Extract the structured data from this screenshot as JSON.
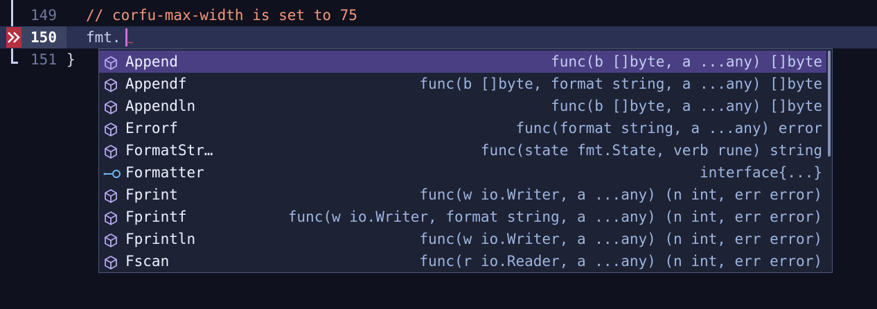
{
  "editor": {
    "lines": [
      {
        "number": "149",
        "text": "// corfu-max-width is set to 75",
        "kind": "comment"
      },
      {
        "number": "150",
        "text": "fmt.",
        "kind": "code",
        "current": true
      },
      {
        "number": "151",
        "text": "}",
        "kind": "code"
      }
    ]
  },
  "completion": {
    "selected_index": 0,
    "candidates": [
      {
        "label": "Append",
        "annotation": "func(b []byte, a ...any) []byte",
        "kind_icon": "function-cube-icon"
      },
      {
        "label": "Appendf",
        "annotation": "func(b []byte, format string, a ...any) []byte",
        "kind_icon": "function-cube-icon"
      },
      {
        "label": "Appendln",
        "annotation": "func(b []byte, a ...any) []byte",
        "kind_icon": "function-cube-icon"
      },
      {
        "label": "Errorf",
        "annotation": "func(format string, a ...any) error",
        "kind_icon": "function-cube-icon"
      },
      {
        "label": "FormatStr…",
        "annotation": "func(state fmt.State, verb rune) string",
        "kind_icon": "function-cube-icon"
      },
      {
        "label": "Formatter",
        "annotation": "interface{...}",
        "kind_icon": "interface-icon"
      },
      {
        "label": "Fprint",
        "annotation": "func(w io.Writer, a ...any) (n int, err error)",
        "kind_icon": "function-cube-icon"
      },
      {
        "label": "Fprintf",
        "annotation": "func(w io.Writer, format string, a ...any) (n int, err error)",
        "kind_icon": "function-cube-icon"
      },
      {
        "label": "Fprintln",
        "annotation": "func(w io.Writer, a ...any) (n int, err error)",
        "kind_icon": "function-cube-icon"
      },
      {
        "label": "Fscan",
        "annotation": "func(r io.Reader, a ...any) (n int, err error)",
        "kind_icon": "function-cube-icon"
      }
    ]
  },
  "colors": {
    "background": "#0f111e",
    "current_line": "#2a3152",
    "comment": "#f2977c",
    "popup_bg": "#1d2235",
    "selection": "#4b3f84",
    "cursor": "#d36cde",
    "icon": "#b7a8f0",
    "error_marker": "#b5303f"
  }
}
